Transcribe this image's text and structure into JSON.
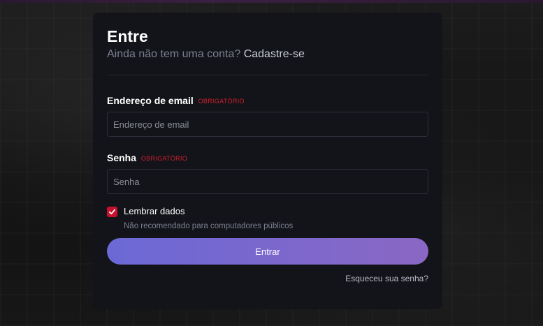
{
  "login": {
    "title": "Entre",
    "subtitle_prefix": "Ainda não tem uma conta?",
    "signup_link": "Cadastre-se",
    "email": {
      "label": "Endereço de email",
      "required": "OBRIGATÓRIO",
      "placeholder": "Endereço de email",
      "value": ""
    },
    "password": {
      "label": "Senha",
      "required": "OBRIGATÓRIO",
      "placeholder": "Senha",
      "value": ""
    },
    "remember": {
      "label": "Lembrar dados",
      "hint": "Não recomendado para computadores públicos",
      "checked": true
    },
    "submit_label": "Entrar",
    "forgot_label": "Esqueceu sua senha?"
  },
  "colors": {
    "accent_red": "#c8102e",
    "button_gradient_start": "#6b69d6",
    "button_gradient_end": "#8a67c4",
    "card_background": "#131419"
  },
  "icons": {
    "checkbox_mark": "checkmark-icon"
  }
}
